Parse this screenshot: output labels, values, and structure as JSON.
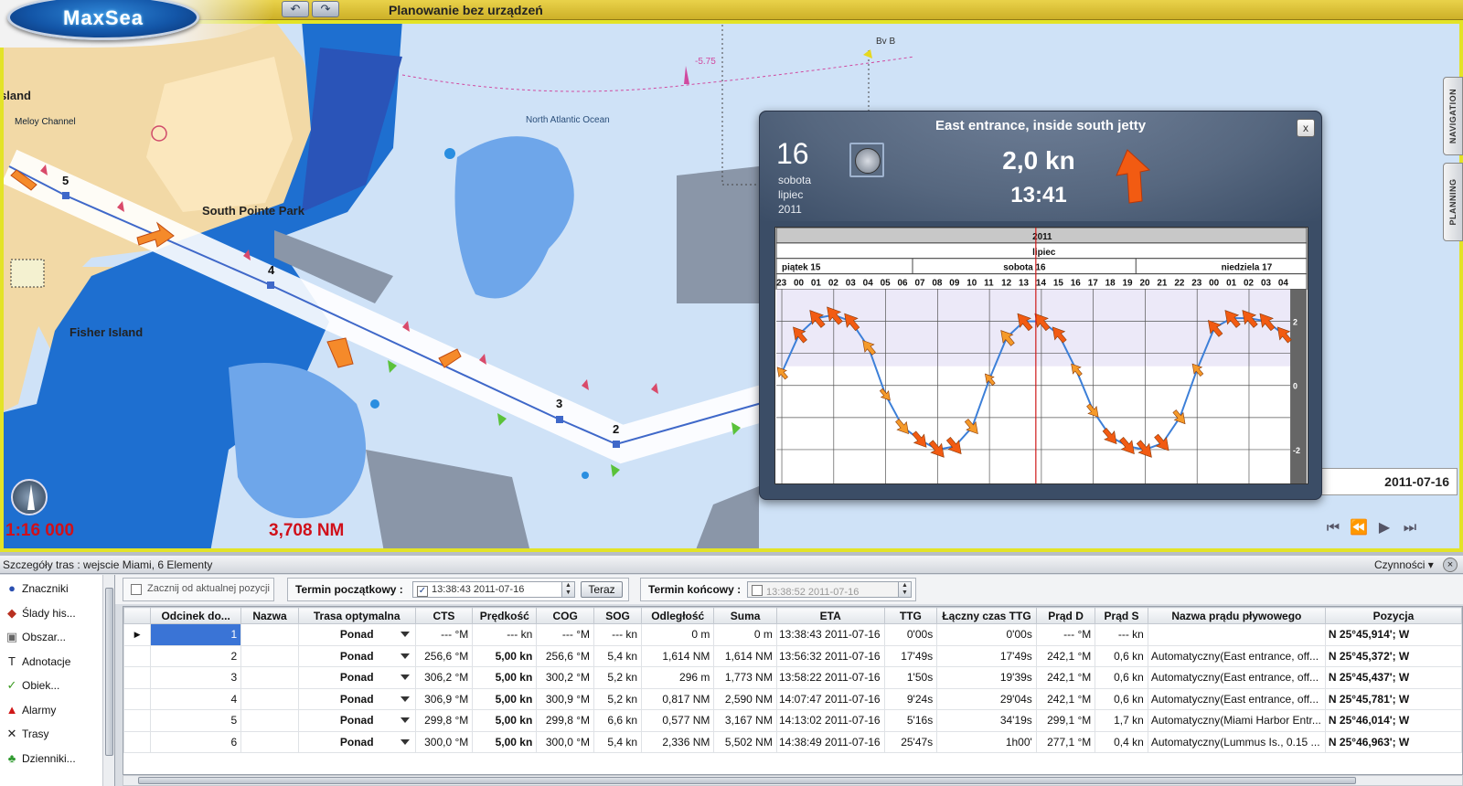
{
  "app": {
    "logo": "MaxSea",
    "title": "Planowanie bez urządzeń",
    "undo_glyph": "↶",
    "redo_glyph": "↷"
  },
  "map": {
    "labels": {
      "ocean": "North Atlantic Ocean",
      "park": "South Pointe Park",
      "fisher": "Fisher Island",
      "island": "sland",
      "channel": "Meloy Channel",
      "buoy": "Bv B",
      "depth": "-5.75"
    },
    "waypoints": [
      "5",
      "4",
      "3",
      "2"
    ],
    "scale": "1:16 000",
    "distance": "3,708 NM",
    "date": "2011-07-16",
    "side_tabs": [
      "NAVIGATION",
      "PLANNING"
    ],
    "playback_glyphs": [
      "⏮",
      "⏪",
      "▶",
      "⏭"
    ]
  },
  "tide": {
    "title": "East entrance, inside south jetty",
    "close": "x",
    "day": "16",
    "weekday": "sobota",
    "month": "lipiec",
    "year": "2011",
    "speed": "2,0 kn",
    "time": "13:41",
    "chart": {
      "year_label": "2011",
      "month_label": "lipiec",
      "days": [
        "piątek 15",
        "sobota 16",
        "niedziela 17"
      ],
      "hours": [
        "23",
        "00",
        "01",
        "02",
        "03",
        "04",
        "05",
        "06",
        "07",
        "08",
        "09",
        "10",
        "11",
        "12",
        "13",
        "14",
        "15",
        "16",
        "17",
        "18",
        "19",
        "20",
        "21",
        "22",
        "23",
        "00",
        "01",
        "02",
        "03",
        "04"
      ],
      "yticks": [
        "2",
        "0",
        "-2"
      ]
    },
    "chart_data": {
      "type": "line",
      "title": "East entrance, inside south jetty",
      "xlabel": "",
      "ylabel": "",
      "x": [
        "23",
        "00",
        "01",
        "02",
        "03",
        "04",
        "05",
        "06",
        "07",
        "08",
        "09",
        "10",
        "11",
        "12",
        "13",
        "14",
        "15",
        "16",
        "17",
        "18",
        "19",
        "20",
        "21",
        "22",
        "23",
        "00",
        "01",
        "02",
        "03",
        "04"
      ],
      "series": [
        {
          "values": [
            0.4,
            1.6,
            2.1,
            2.2,
            2.0,
            1.2,
            -0.3,
            -1.3,
            -1.7,
            -2.0,
            -1.9,
            -1.3,
            0.2,
            1.5,
            2.0,
            2.0,
            1.6,
            0.5,
            -0.8,
            -1.6,
            -1.9,
            -2.0,
            -1.8,
            -1.0,
            0.5,
            1.8,
            2.1,
            2.1,
            2.0,
            1.6
          ]
        }
      ],
      "ylim": [
        -3,
        3
      ],
      "current_time": "13:41",
      "grid": true
    }
  },
  "panel": {
    "title": "Szczegóły tras : wejscie Miami, 6 Elementy",
    "actions": "Czynności",
    "close": "×"
  },
  "sidebar": {
    "items": [
      {
        "label": "Znaczniki",
        "icon": "●",
        "color": "#2a4fb0"
      },
      {
        "label": "Ślady his...",
        "icon": "◆",
        "color": "#b83020"
      },
      {
        "label": "Obszar...",
        "icon": "▣",
        "color": "#666666"
      },
      {
        "label": "Adnotacje",
        "icon": "T",
        "color": "#222222"
      },
      {
        "label": "Obiek...",
        "icon": "✓",
        "color": "#3a9a20"
      },
      {
        "label": "Alarmy",
        "icon": "▲",
        "color": "#d01818"
      },
      {
        "label": "Trasy",
        "icon": "✕",
        "color": "#222222"
      },
      {
        "label": "Dzienniki...",
        "icon": "♣",
        "color": "#2f9a2f"
      }
    ]
  },
  "controls": {
    "start_from_position": "Zacznij od aktualnej pozycji",
    "start_label": "Termin początkowy :",
    "start_value": "13:38:43  2011-07-16",
    "now_button": "Teraz",
    "end_label": "Termin końcowy :",
    "end_value": "13:38:52  2011-07-16"
  },
  "table": {
    "columns": [
      "",
      "Odcinek do...",
      "Nazwa",
      "Trasa optymalna",
      "CTS",
      "Prędkość",
      "COG",
      "SOG",
      "Odległość",
      "Suma",
      "ETA",
      "TTG",
      "Łączny czas TTG",
      "Prąd D",
      "Prąd S",
      "Nazwa prądu pływowego",
      "Pozycja"
    ],
    "rows": [
      [
        "▶",
        "1",
        "",
        "Ponad",
        "--- °M",
        "--- kn",
        "--- °M",
        "--- kn",
        "0 m",
        "0 m",
        "13:38:43 2011-07-16",
        "0'00s",
        "0'00s",
        "--- °M",
        "--- kn",
        "",
        "N 25°45,914'; W"
      ],
      [
        "",
        "2",
        "",
        "Ponad",
        "256,6 °M",
        "5,00 kn",
        "256,6 °M",
        "5,4 kn",
        "1,614 NM",
        "1,614 NM",
        "13:56:32 2011-07-16",
        "17'49s",
        "17'49s",
        "242,1 °M",
        "0,6 kn",
        "Automatyczny(East entrance, off...",
        "N 25°45,372'; W"
      ],
      [
        "",
        "3",
        "",
        "Ponad",
        "306,2 °M",
        "5,00 kn",
        "300,2 °M",
        "5,2 kn",
        "296 m",
        "1,773 NM",
        "13:58:22 2011-07-16",
        "1'50s",
        "19'39s",
        "242,1 °M",
        "0,6 kn",
        "Automatyczny(East entrance, off...",
        "N 25°45,437'; W"
      ],
      [
        "",
        "4",
        "",
        "Ponad",
        "306,9 °M",
        "5,00 kn",
        "300,9 °M",
        "5,2 kn",
        "0,817 NM",
        "2,590 NM",
        "14:07:47 2011-07-16",
        "9'24s",
        "29'04s",
        "242,1 °M",
        "0,6 kn",
        "Automatyczny(East entrance, off...",
        "N 25°45,781'; W"
      ],
      [
        "",
        "5",
        "",
        "Ponad",
        "299,8 °M",
        "5,00 kn",
        "299,8 °M",
        "6,6 kn",
        "0,577 NM",
        "3,167 NM",
        "14:13:02 2011-07-16",
        "5'16s",
        "34'19s",
        "299,1 °M",
        "1,7 kn",
        "Automatyczny(Miami Harbor Entr...",
        "N 25°46,014'; W"
      ],
      [
        "",
        "6",
        "",
        "Ponad",
        "300,0 °M",
        "5,00 kn",
        "300,0 °M",
        "5,4 kn",
        "2,336 NM",
        "5,502 NM",
        "14:38:49 2011-07-16",
        "25'47s",
        "1h00'",
        "277,1 °M",
        "0,4 kn",
        "Automatyczny(Lummus Is., 0.15 ...",
        "N 25°46,963'; W"
      ]
    ]
  },
  "colors": {
    "accent_yellow": "#e3e327",
    "route_blue": "#3f68c9",
    "land": "#f2d9a6",
    "deep_water": "#1e6fd0",
    "shallow_water": "#9cc4f0",
    "selection": "#3a74d6",
    "tide_curve": "#3c7fd8",
    "tide_arrow": "#f25b12"
  }
}
